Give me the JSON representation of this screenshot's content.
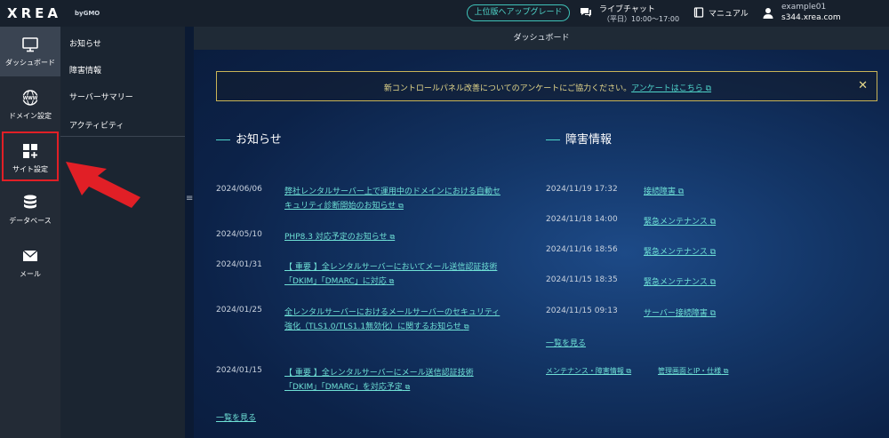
{
  "header": {
    "logo": "XREA",
    "logo_by": "byGMO",
    "upgrade_label": "上位版へアップグレード",
    "chat_title": "ライブチャット",
    "chat_hours": "（平日）10:00～17:00",
    "manual_label": "マニュアル",
    "account_user": "example01",
    "account_server": "s344.xrea.com"
  },
  "nav": {
    "items": [
      {
        "label": "ダッシュボード",
        "icon": "monitor-icon"
      },
      {
        "label": "ドメイン設定",
        "icon": "www-globe-icon"
      },
      {
        "label": "サイト設定",
        "icon": "grid-plus-icon"
      },
      {
        "label": "データベース",
        "icon": "database-icon"
      },
      {
        "label": "メール",
        "icon": "envelope-icon"
      }
    ]
  },
  "subnav": {
    "items": [
      "お知らせ",
      "障害情報",
      "サーバーサマリー",
      "アクティビティ"
    ]
  },
  "main": {
    "title": "ダッシュボード",
    "survey_text": "新コントロールパネル改善についてのアンケートにご協力ください。",
    "survey_link": "アンケートはこちら",
    "survey_close": "✕"
  },
  "news": {
    "title": "お知らせ",
    "items": [
      {
        "date": "2024/06/06",
        "text": "弊社レンタルサーバー上で運用中のドメインにおける自動セキュリティ診断開始のお知らせ"
      },
      {
        "date": "2024/05/10",
        "text": "PHP8.3 対応予定のお知らせ"
      },
      {
        "date": "2024/01/31",
        "text": "【 重要 】全レンタルサーバーにおいてメール送信認証技術 「DKIM」「DMARC」に対応"
      },
      {
        "date": "2024/01/25",
        "text": "全レンタルサーバーにおけるメールサーバーのセキュリティ強化（TLS1.0/TLS1.1無効化）に関するお知らせ"
      },
      {
        "date": "2024/01/15",
        "text": "【 重要 】全レンタルサーバーにメール送信認証技術 「DKIM」「DMARC」を対応予定"
      }
    ],
    "more": "一覧を見る"
  },
  "incidents": {
    "title": "障害情報",
    "items": [
      {
        "date": "2024/11/19 17:32",
        "text": "接続障害"
      },
      {
        "date": "2024/11/18 14:00",
        "text": "緊急メンテナンス"
      },
      {
        "date": "2024/11/16 18:56",
        "text": "緊急メンテナンス"
      },
      {
        "date": "2024/11/15 18:35",
        "text": "緊急メンテナンス"
      },
      {
        "date": "2024/11/15 09:13",
        "text": "サーバー接続障害"
      }
    ],
    "more": "一覧を見る",
    "footer_links": [
      "メンテナンス・障害情報",
      "管理画面とIP・仕様"
    ]
  },
  "colors": {
    "accent": "#4fd6cb",
    "highlight": "#e11f26",
    "survey_border": "#c9b457"
  }
}
